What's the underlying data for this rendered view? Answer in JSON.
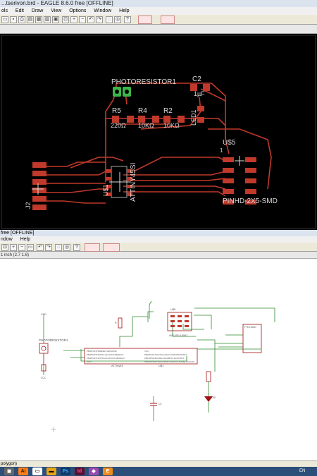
{
  "board_window": {
    "title": "...tserivon.brd - EAGLE 8.6.0 free [OFFLINE]",
    "menu": [
      "ols",
      "Edit",
      "Draw",
      "View",
      "Options",
      "Window",
      "Help"
    ]
  },
  "board": {
    "labels": {
      "photoresistor": "PHOTORESISTOR1",
      "c2": "C2",
      "c2_value": "1µF",
      "r5": "R5",
      "r5_value": "220Ω",
      "r4": "R4",
      "r4_value": "10KΩ",
      "r2": "R2",
      "r2_value": "10KΩ",
      "led1": "LED1",
      "u5": "U$5",
      "u5_pin": "1",
      "u1": "U$1",
      "attiny": "ATTINY45SI",
      "j2": "J2",
      "pinhd": "PINHD-2X5-SMD"
    }
  },
  "schematic_window": {
    "title": "free [OFFLINE]",
    "menu": [
      "ndow",
      "Help"
    ],
    "coord_readout": "1 inch (2.7 1.6)"
  },
  "schematic": {
    "labels": {
      "photoresistor": "PHOTORESISTOR1",
      "u_top": "U$5",
      "avr_isp": "AVR-ISP-6-SMD",
      "attiny_top": "ATTiny45",
      "attiny_name": "U$1",
      "ftdi": "FTDI-SMD",
      "gnd": "GND",
      "vcc": "VCC",
      "r": "R",
      "c2": "C2",
      "led": "LED",
      "pin_left_1": "PB5/PCINT5/RESET/ADC0/DW",
      "pin_left_2": "PB3/PCINT3/XTAL1/CLKI/OC1B/ADC3",
      "pin_left_3": "PB4/PCINT4/XTAL2/CLKO/OC1B/ADC2",
      "pin_left_4": "GND",
      "pin_right_1": "VCC",
      "pin_right_2": "PB2/SCK/USCK/SCL/ADC1/T0/INT0/PCINT2",
      "pin_right_3": "PB1/MISO/DO/AIN1/OC0B/OC1A/PCINT1",
      "pin_right_4": "PB0/MOSI/DI/SDA/AIN0/OC0A/OC1A/AREF/PCINT0"
    }
  },
  "status_bar": {
    "text": "polygon)"
  },
  "taskbar": {
    "apps": [
      "Ai",
      "Ps",
      "Id",
      "E"
    ],
    "tray": "EN"
  },
  "colors": {
    "board_bg": "#000000",
    "trace": "#c0392b",
    "pad_green": "#3cb54a",
    "schematic_wire": "#2e8b2e",
    "schematic_part": "#a01010",
    "taskbar": "#2c4f7a"
  }
}
